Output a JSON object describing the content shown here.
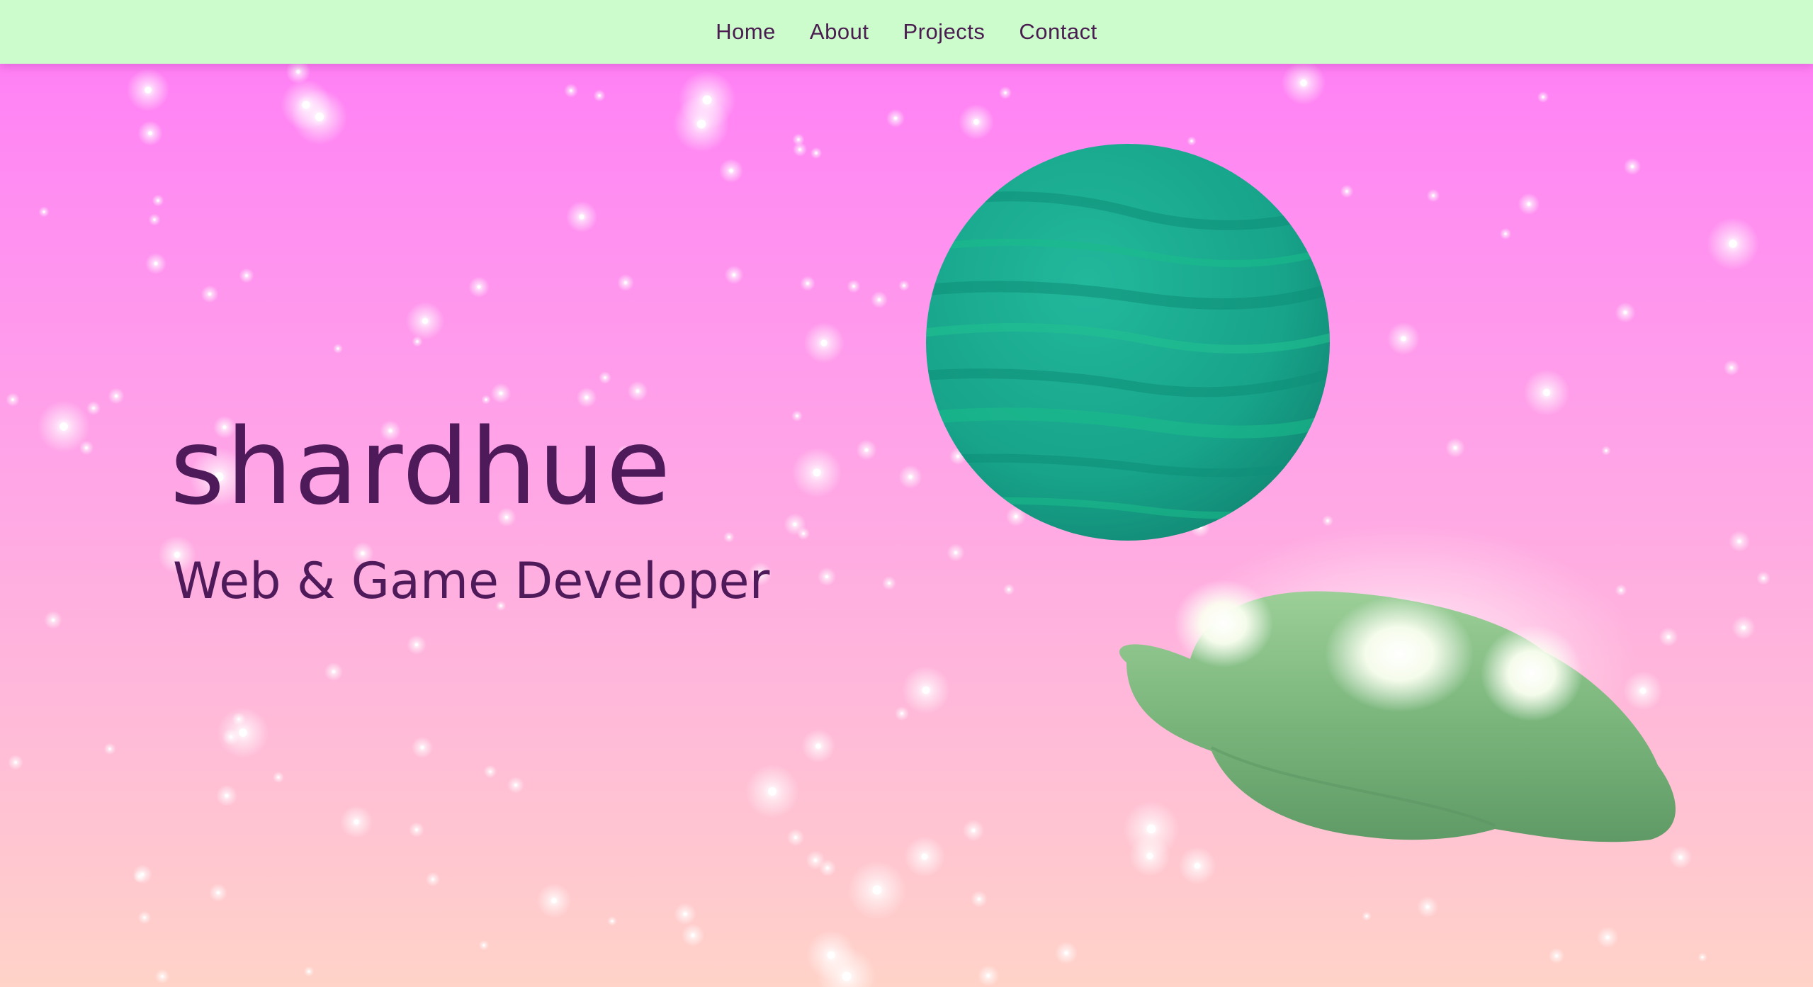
{
  "nav": {
    "items": [
      {
        "label": "Home"
      },
      {
        "label": "About"
      },
      {
        "label": "Projects"
      },
      {
        "label": "Contact"
      }
    ]
  },
  "hero": {
    "name": "shardhue",
    "role": "Web & Game Developer"
  },
  "colors": {
    "nav_bg": "#ccfccc",
    "text": "#4e1a5a",
    "planet": "#1aa890",
    "ufo": "#7bb87e",
    "ufo_light": "#fffff0"
  },
  "scene": {
    "objects": [
      "planet-icon",
      "ufo-icon",
      "star-icon"
    ]
  }
}
